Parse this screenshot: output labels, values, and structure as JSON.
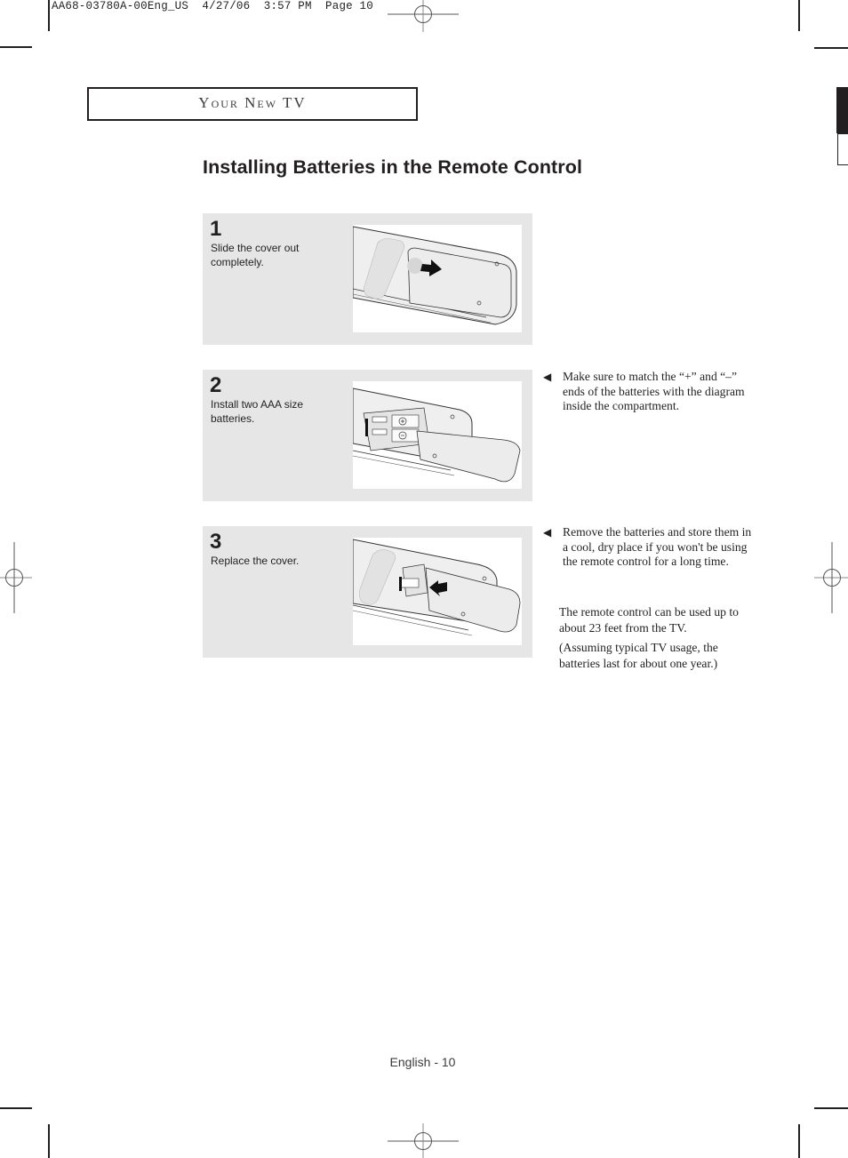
{
  "slug": {
    "text": "AA68-03780A-00Eng_US  4/27/06  3:57 PM  Page 10"
  },
  "section": {
    "title": "Your New TV"
  },
  "page_title": "Installing Batteries in the Remote Control",
  "steps": [
    {
      "number": "1",
      "text": "Slide the cover out completely.",
      "illustration": "remote-back-slide-cover-out"
    },
    {
      "number": "2",
      "text": "Install two AAA size batteries.",
      "illustration": "remote-battery-compartment-open"
    },
    {
      "number": "3",
      "text": "Replace the cover.",
      "illustration": "remote-replace-cover"
    }
  ],
  "notes": [
    {
      "bullet_icon": "left-triangle-bullet",
      "text": "Make sure to match the “+” and “–” ends of the batteries with the diagram inside the compartment."
    },
    {
      "bullet_icon": "left-triangle-bullet",
      "text": "Remove the batteries and store them in a cool, dry place if you won't be using the remote control for a long time."
    }
  ],
  "info": [
    "The remote control can be used up to about 23 feet from the TV.",
    "(Assuming typical TV usage, the batteries last for about one year.)"
  ],
  "footer": {
    "text": "English - 10"
  },
  "colors": {
    "ink": "#231f20",
    "panel": "#e6e6e6"
  }
}
